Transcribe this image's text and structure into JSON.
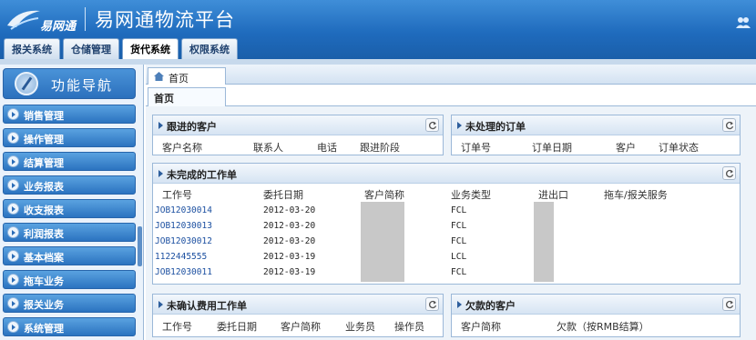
{
  "header": {
    "logo_text": "易网通",
    "title": "易网通物流平台",
    "tabs": [
      "报关系统",
      "仓储管理",
      "货代系统",
      "权限系统"
    ],
    "active_tab": 2
  },
  "sidebar": {
    "title": "功能导航",
    "items": [
      "销售管理",
      "操作管理",
      "结算管理",
      "业务报表",
      "收支报表",
      "利润报表",
      "基本档案",
      "拖车业务",
      "报关业务",
      "系统管理"
    ]
  },
  "main": {
    "home_tab": "首页",
    "sub_tab": "首页",
    "panels": {
      "followup": {
        "title": "跟进的客户",
        "columns": [
          "客户名称",
          "联系人",
          "电话",
          "跟进阶段"
        ]
      },
      "orders": {
        "title": "未处理的订单",
        "columns": [
          "订单号",
          "订单日期",
          "客户",
          "订单状态"
        ]
      },
      "workorders": {
        "title": "未完成的工作单",
        "columns": [
          "工作号",
          "委托日期",
          "客户简称",
          "业务类型",
          "进出口",
          "拖车/报关服务"
        ],
        "rows": [
          [
            "JOB12030014",
            "2012-03-20",
            "FCL"
          ],
          [
            "JOB12030013",
            "2012-03-20",
            "FCL"
          ],
          [
            "JOB12030012",
            "2012-03-20",
            "FCL"
          ],
          [
            "1122445555",
            "2012-03-19",
            "LCL"
          ],
          [
            "JOB12030011",
            "2012-03-19",
            "FCL"
          ]
        ]
      },
      "fees": {
        "title": "未确认费用工作单",
        "columns": [
          "工作号",
          "委托日期",
          "客户简称",
          "业务员",
          "操作员"
        ]
      },
      "debts": {
        "title": "欠款的客户",
        "columns": [
          "客户简称",
          "欠款（按RMB结算）"
        ]
      }
    }
  }
}
